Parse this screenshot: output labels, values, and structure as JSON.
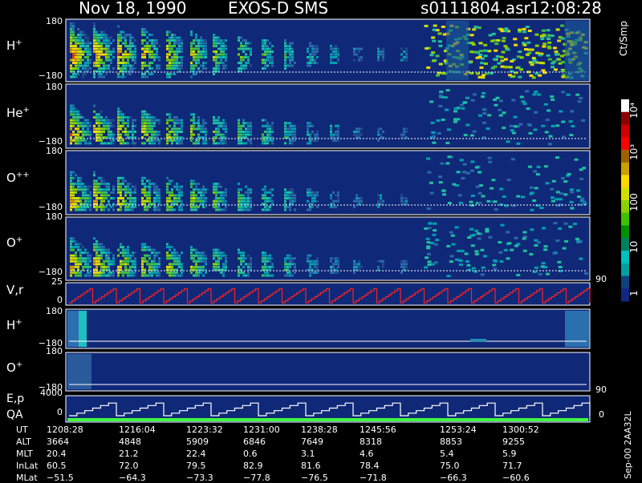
{
  "header": {
    "date": "Nov 18, 1990",
    "instrument": "EXOS-D SMS",
    "file": "s0111804.asr",
    "time": "12:08:28"
  },
  "panels": [
    {
      "id": "h_plus",
      "label_base": "H",
      "label_sup": "+",
      "top": "180",
      "bottom": "−180"
    },
    {
      "id": "he_plus",
      "label_base": "He",
      "label_sup": "+",
      "top": "180",
      "bottom": "−180"
    },
    {
      "id": "o_plusplus",
      "label_base": "O",
      "label_sup": "++",
      "top": "180",
      "bottom": "−180"
    },
    {
      "id": "o_plus",
      "label_base": "O",
      "label_sup": "+",
      "top": "180",
      "bottom": "−180"
    },
    {
      "id": "vr",
      "label_base": "V,r",
      "label_sup": "",
      "top": "25",
      "bottom": "0",
      "right": "90"
    },
    {
      "id": "h_plus_2",
      "label_base": "H",
      "label_sup": "+",
      "top": "180",
      "bottom": "−180"
    },
    {
      "id": "o_plus_2",
      "label_base": "O",
      "label_sup": "+",
      "top": "180",
      "bottom": "−180",
      "right": "90"
    },
    {
      "id": "ep",
      "label_base": "E,p",
      "label2": "QA",
      "label_sup": "",
      "top": "4000",
      "bottom": "0",
      "right": "0"
    }
  ],
  "colorbar": {
    "title": "Ct/Smp",
    "labels": [
      "10⁴",
      "10³",
      "100",
      "10",
      "1"
    ],
    "colors": [
      "#ffffff",
      "#8b0000",
      "#d00000",
      "#ff0000",
      "#a06000",
      "#c8a000",
      "#ffd800",
      "#cfe000",
      "#88d000",
      "#40c000",
      "#009000",
      "#008060",
      "#00c0c0",
      "#00a0a0",
      "#104080",
      "#102880"
    ]
  },
  "ephemeris": {
    "labels": [
      "UT",
      "ALT",
      "MLT",
      "InLat",
      "MLat"
    ],
    "columns": [
      [
        "1208:28",
        "3664",
        "20.4",
        "60.5",
        "−51.5"
      ],
      [
        "1216:04",
        "4848",
        "21.2",
        "72.0",
        "−64.3"
      ],
      [
        "1223:32",
        "5909",
        "22.4",
        "79.5",
        "−73.3"
      ],
      [
        "1231:00",
        "6846",
        "0.6",
        "82.9",
        "−77.8"
      ],
      [
        "1238:28",
        "7649",
        "3.1",
        "81.6",
        "−76.5"
      ],
      [
        "1245:56",
        "8318",
        "4.6",
        "78.4",
        "−71.8"
      ],
      [
        "1253:24",
        "8853",
        "5.4",
        "75.0",
        "−66.3"
      ],
      [
        "1300:52",
        "9255",
        "5.9",
        "71.7",
        "−60.6"
      ]
    ]
  },
  "footer_tag": "Sep-00 2AA32L",
  "colors": {
    "background": "#000000",
    "panel": "#102878",
    "accent_red": "#ff2020",
    "accent_green": "#40ff40"
  },
  "chart_data": {
    "type": "heatmap",
    "title": "Nov 18, 1990    EXOS-D SMS",
    "x_ticks": [
      "1208:28",
      "1216:04",
      "1223:32",
      "1231:00",
      "1238:28",
      "1245:56",
      "1253:24",
      "1300:52"
    ],
    "series": [
      {
        "name": "H+",
        "ylim": [
          -180,
          180
        ]
      },
      {
        "name": "He+",
        "ylim": [
          -180,
          180
        ]
      },
      {
        "name": "O++",
        "ylim": [
          -180,
          180
        ]
      },
      {
        "name": "O+",
        "ylim": [
          -180,
          180
        ]
      },
      {
        "name": "V,r",
        "ylim": [
          0,
          25
        ]
      },
      {
        "name": "H+",
        "ylim": [
          -180,
          180
        ]
      },
      {
        "name": "O+",
        "ylim": [
          -180,
          180
        ]
      },
      {
        "name": "E,p",
        "ylim": [
          0,
          4000
        ]
      }
    ],
    "color_scale": {
      "label": "Ct/Smp",
      "range": [
        1,
        10000
      ],
      "scale": "log"
    }
  }
}
